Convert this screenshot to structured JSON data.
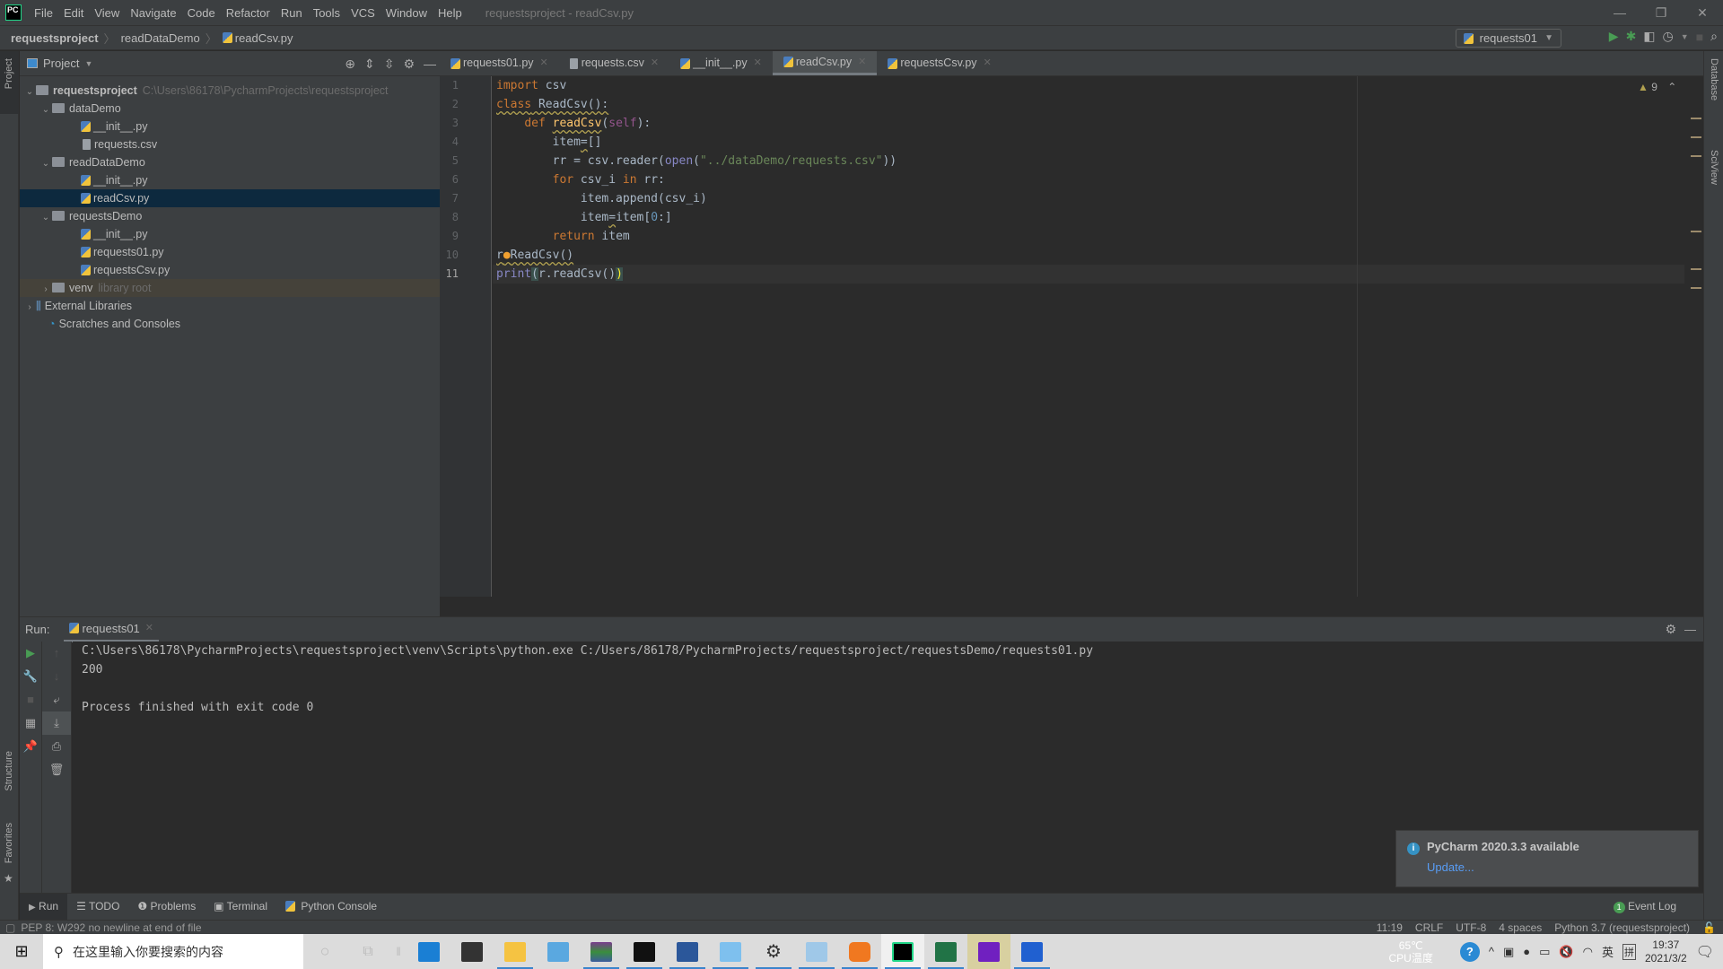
{
  "menubar": {
    "logo": "PC",
    "items": [
      "File",
      "Edit",
      "View",
      "Navigate",
      "Code",
      "Refactor",
      "Run",
      "Tools",
      "VCS",
      "Window",
      "Help"
    ],
    "window_title": "requestsproject - readCsv.py"
  },
  "window_controls": {
    "minimize": "—",
    "restore": "❐",
    "close": "✕"
  },
  "navbar": {
    "breadcrumbs": [
      "requestsproject",
      "readDataDemo",
      "readCsv.py"
    ],
    "run_config": "requests01"
  },
  "left_strip": {
    "project_label": "Project",
    "structure_label": "Structure",
    "favorites_label": "Favorites"
  },
  "right_strip": {
    "database_label": "Database",
    "sciview_label": "SciView"
  },
  "project_panel": {
    "title": "Project",
    "tree": [
      {
        "label": "requestsproject",
        "hint": "C:\\Users\\86178\\PycharmProjects\\requestsproject",
        "type": "folder",
        "depth": 0,
        "expanded": true,
        "bold": true
      },
      {
        "label": "dataDemo",
        "type": "package",
        "depth": 1,
        "expanded": true
      },
      {
        "label": "__init__.py",
        "type": "python",
        "depth": 2
      },
      {
        "label": "requests.csv",
        "type": "text",
        "depth": 2
      },
      {
        "label": "readDataDemo",
        "type": "package",
        "depth": 1,
        "expanded": true
      },
      {
        "label": "__init__.py",
        "type": "python",
        "depth": 2
      },
      {
        "label": "readCsv.py",
        "type": "python",
        "depth": 2,
        "selected": true
      },
      {
        "label": "requestsDemo",
        "type": "package",
        "depth": 1,
        "expanded": true
      },
      {
        "label": "__init__.py",
        "type": "python",
        "depth": 2
      },
      {
        "label": "requests01.py",
        "type": "python",
        "depth": 2
      },
      {
        "label": "requestsCsv.py",
        "type": "python",
        "depth": 2
      },
      {
        "label": "venv",
        "hint": "library root",
        "type": "folder",
        "depth": 1,
        "expanded": false,
        "venv": true
      },
      {
        "label": "External Libraries",
        "type": "libraries",
        "depth": 0,
        "expanded": false
      },
      {
        "label": "Scratches and Consoles",
        "type": "scratches",
        "depth": 0
      }
    ]
  },
  "editor": {
    "tabs": [
      {
        "label": "requests01.py",
        "type": "python"
      },
      {
        "label": "requests.csv",
        "type": "text"
      },
      {
        "label": "__init__.py",
        "type": "python"
      },
      {
        "label": "readCsv.py",
        "type": "python",
        "active": true
      },
      {
        "label": "requestsCsv.py",
        "type": "python"
      }
    ],
    "inspection_count": "9",
    "line_numbers": [
      "1",
      "2",
      "3",
      "4",
      "5",
      "6",
      "7",
      "8",
      "9",
      "10",
      "11"
    ],
    "code_lines": [
      "import csv",
      "class ReadCsv():",
      "    def readCsv(self):",
      "        item=[]",
      "        rr = csv.reader(open(\"../dataDemo/requests.csv\"))",
      "        for csv_i in rr:",
      "            item.append(csv_i)",
      "            item=item[0:]",
      "        return item",
      "r=ReadCsv()",
      "print(r.readCsv())"
    ]
  },
  "run_panel": {
    "label": "Run:",
    "tab": "requests01",
    "output": [
      "C:\\Users\\86178\\PycharmProjects\\requestsproject\\venv\\Scripts\\python.exe C:/Users/86178/PycharmProjects/requestsproject/requestsDemo/requests01.py",
      "200",
      "",
      "Process finished with exit code 0"
    ]
  },
  "notification": {
    "title": "PyCharm 2020.3.3 available",
    "link": "Update..."
  },
  "bottom_tools": [
    "Run",
    "TODO",
    "Problems",
    "Terminal",
    "Python Console"
  ],
  "event_log": {
    "count": "1",
    "label": "Event Log"
  },
  "status_bar": {
    "message": "PEP 8: W292 no newline at end of file",
    "position": "11:19",
    "line_sep": "CRLF",
    "encoding": "UTF-8",
    "indent": "4 spaces",
    "interpreter": "Python 3.7 (requestsproject)"
  },
  "taskbar": {
    "search_placeholder": "在这里输入你要搜索的内容",
    "apps": [
      "cortana",
      "task-view",
      "mail",
      "store",
      "file-explorer",
      "remote-desktop",
      "winrar",
      "terminal",
      "word",
      "control-panel",
      "settings",
      "notepad",
      "app-orange",
      "pycharm",
      "excel",
      "app-purple",
      "app-blue"
    ],
    "cpu_temp": "65℃",
    "cpu_label": "CPU温度",
    "ime_lang": "英",
    "ime_mode": "拼",
    "time": "19:37",
    "date": "2021/3/2"
  }
}
